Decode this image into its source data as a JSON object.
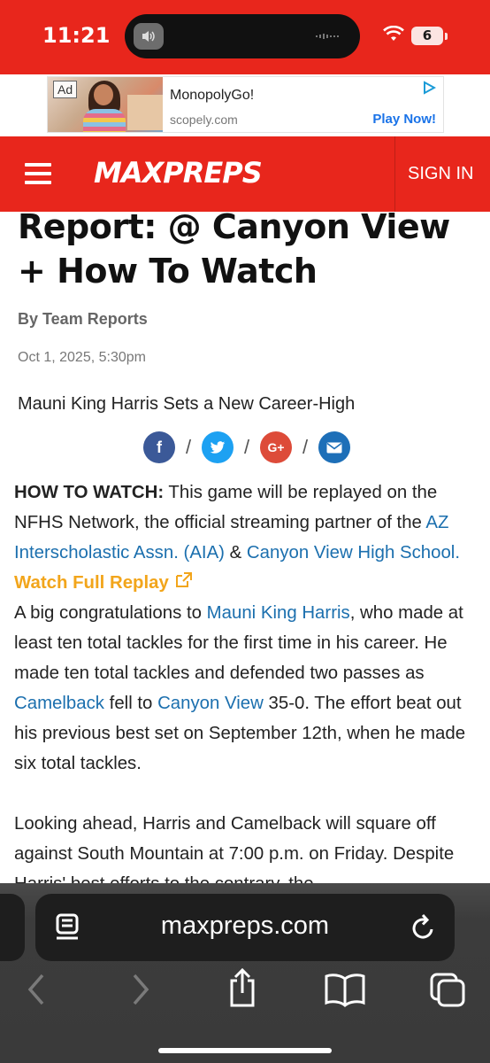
{
  "status_bar": {
    "time": "11:21",
    "battery": "6"
  },
  "ad": {
    "badge": "Ad",
    "title": "MonopolyGo!",
    "domain": "scopely.com",
    "cta": "Play Now!"
  },
  "header": {
    "logo": "MAXPREPS",
    "sign_in": "SIGN IN"
  },
  "article": {
    "headline": "Report: @ Canyon View + How To Watch",
    "byline": "By Team Reports",
    "date": "Oct 1, 2025, 5:30pm",
    "subtitle": "Mauni King Harris Sets a New Career-High",
    "share_sep": "/",
    "how_to_watch_label": "HOW TO WATCH:",
    "how_to_watch_text": " This game will be replayed on the NFHS Network, the official streaming partner of the ",
    "link_aia": "AZ Interscholastic Assn. (AIA)",
    "amp": " & ",
    "link_canyon_view_hs": "Canyon View High School",
    "period": ". ",
    "watch_replay": "Watch Full Replay",
    "p2_a": "A big congratulations to ",
    "link_player": "Mauni King Harris",
    "p2_b": ", who made at least ten total tackles for the first time in his career. He made ten total tackles and defended two passes as ",
    "link_camelback": "Camelback",
    "p2_c": " fell to ",
    "link_canyon_view": "Canyon View",
    "p2_d": " 35-0. The effort beat out his previous best set on September 12th, when he made six total tackles.",
    "p3": "Looking ahead, Harris and Camelback will square off against South Mountain at 7:00 p.m. on Friday. Despite Harris' best efforts to the contrary, the"
  },
  "browser": {
    "url": "maxpreps.com"
  }
}
